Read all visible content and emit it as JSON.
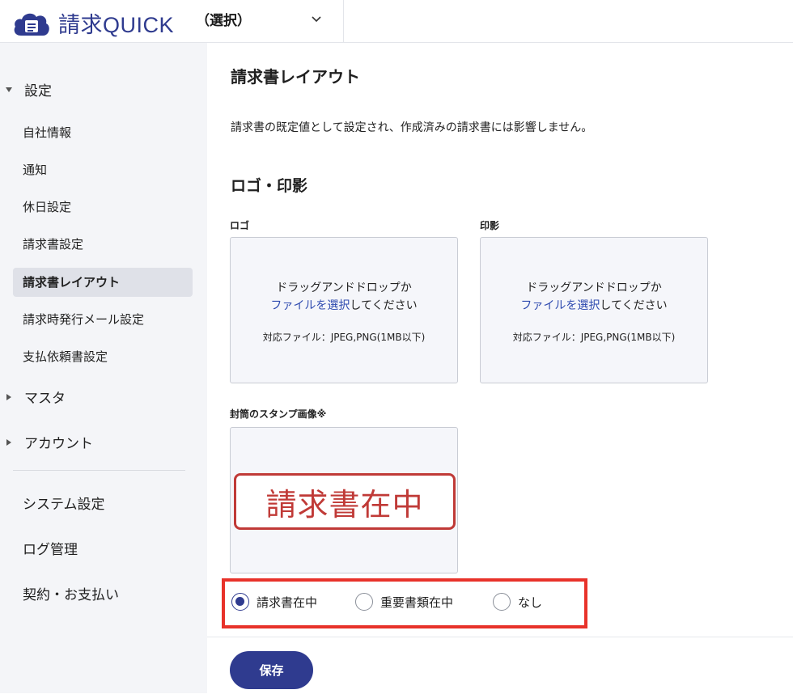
{
  "header": {
    "logo_text": "請求QUICK",
    "org_selector": "（選択）"
  },
  "sidebar": {
    "settings_section": "設定",
    "settings_items": [
      {
        "label": "自社情報"
      },
      {
        "label": "通知"
      },
      {
        "label": "休日設定"
      },
      {
        "label": "請求書設定"
      },
      {
        "label": "請求書レイアウト",
        "active": true
      },
      {
        "label": "請求時発行メール設定"
      },
      {
        "label": "支払依頼書設定"
      }
    ],
    "master_section": "マスタ",
    "account_section": "アカウント",
    "system_settings": "システム設定",
    "log_management": "ログ管理",
    "contract_payment": "契約・お支払い"
  },
  "main": {
    "title": "請求書レイアウト",
    "description": "請求書の既定値として設定され、作成済みの請求書には影響しません。",
    "logo_section_title": "ロゴ・印影",
    "logo_label": "ロゴ",
    "seal_label": "印影",
    "dropzone": {
      "line1": "ドラッグアンドドロップか",
      "link": "ファイルを選択",
      "line2_suffix": "してください",
      "note": "対応ファイル：JPEG,PNG(1MB以下)"
    },
    "stamp_label": "封筒のスタンプ画像※",
    "stamp_text": "請求書在中",
    "stamp_options": [
      {
        "label": "請求書在中",
        "checked": true
      },
      {
        "label": "重要書類在中",
        "checked": false
      },
      {
        "label": "なし",
        "checked": false
      }
    ],
    "save_button": "保存"
  },
  "colors": {
    "brand": "#2f3b8f",
    "stamp_red": "#c03a37",
    "highlight_red": "#e8322a",
    "sidebar_bg": "#f4f5f8"
  }
}
